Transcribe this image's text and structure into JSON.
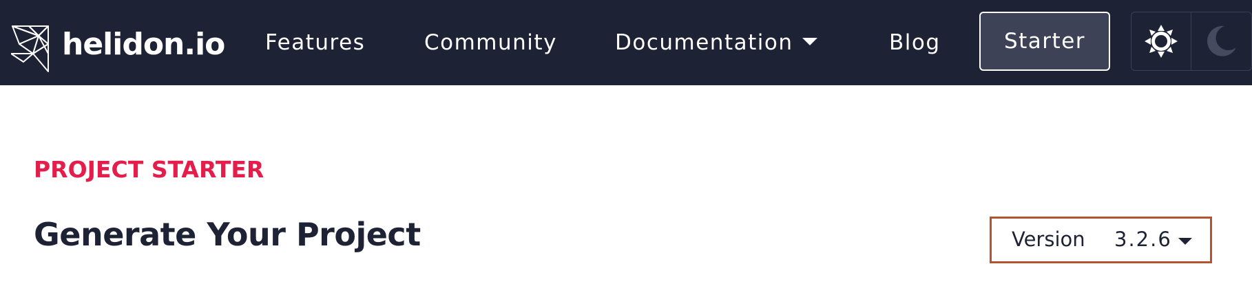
{
  "header": {
    "logo_text": "helidon.io",
    "logo_icon": "helidon-bird-icon",
    "nav": {
      "features": "Features",
      "community": "Community",
      "documentation": "Documentation",
      "blog": "Blog"
    },
    "starter_label": "Starter",
    "theme": {
      "light_icon": "sun-icon",
      "dark_icon": "moon-icon",
      "selected": "light"
    }
  },
  "main": {
    "eyebrow": "PROJECT STARTER",
    "title": "Generate Your Project",
    "version": {
      "label": "Version",
      "value": "3.2.6"
    }
  },
  "colors": {
    "navbar_bg": "#1e2235",
    "starter_bg": "#3e4257",
    "accent_red": "#e41d4b",
    "title_text": "#1e2235",
    "version_border": "#b4532d"
  }
}
